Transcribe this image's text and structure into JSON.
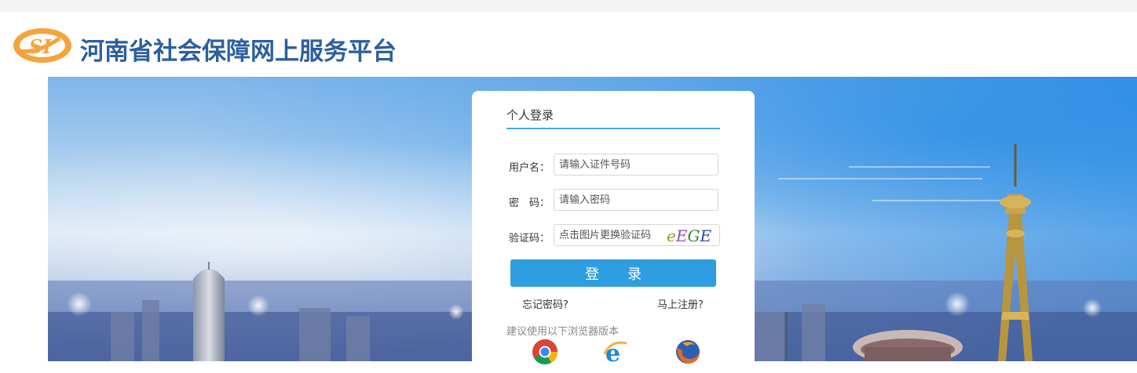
{
  "header": {
    "logo_text": "SI",
    "site_title": "河南省社会保障网上服务平台"
  },
  "login": {
    "panel_title": "个人登录",
    "username_label": "用户名：",
    "username_placeholder": "请输入证件号码",
    "password_label": "密　码：",
    "password_placeholder": "请输入密码",
    "captcha_label": "验证码：",
    "captcha_placeholder": "点击图片更换验证码",
    "captcha_code": "eEGE",
    "login_button": "登　　录",
    "forgot_link": "忘记密码?",
    "register_link": "马上注册?",
    "browser_note": "建议使用以下浏览器版本",
    "browsers": [
      "chrome-icon",
      "ie-icon",
      "firefox-icon"
    ]
  },
  "colors": {
    "brand_blue": "#2c5f9e",
    "logo_orange": "#f5a33a",
    "button_blue": "#2f9ee0",
    "title_underline": "#4aa8e6"
  }
}
